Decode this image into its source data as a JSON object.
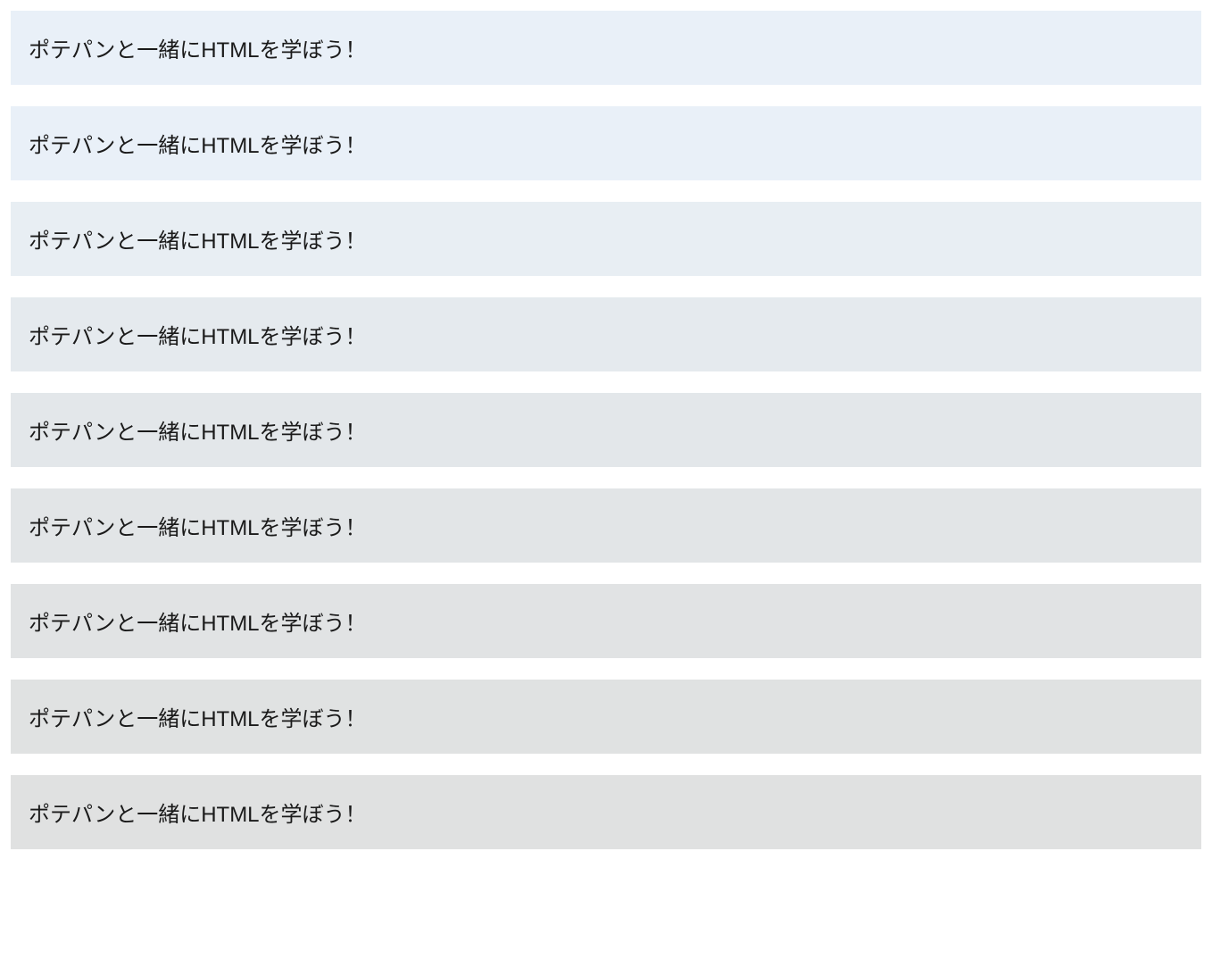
{
  "rows": [
    "ポテパンと一緒にHTMLを学ぼう！",
    "ポテパンと一緒にHTMLを学ぼう！",
    "ポテパンと一緒にHTMLを学ぼう！",
    "ポテパンと一緒にHTMLを学ぼう！",
    "ポテパンと一緒にHTMLを学ぼう！",
    "ポテパンと一緒にHTMLを学ぼう！",
    "ポテパンと一緒にHTMLを学ぼう！",
    "ポテパンと一緒にHTMLを学ぼう！",
    "ポテパンと一緒にHTMLを学ぼう！"
  ]
}
